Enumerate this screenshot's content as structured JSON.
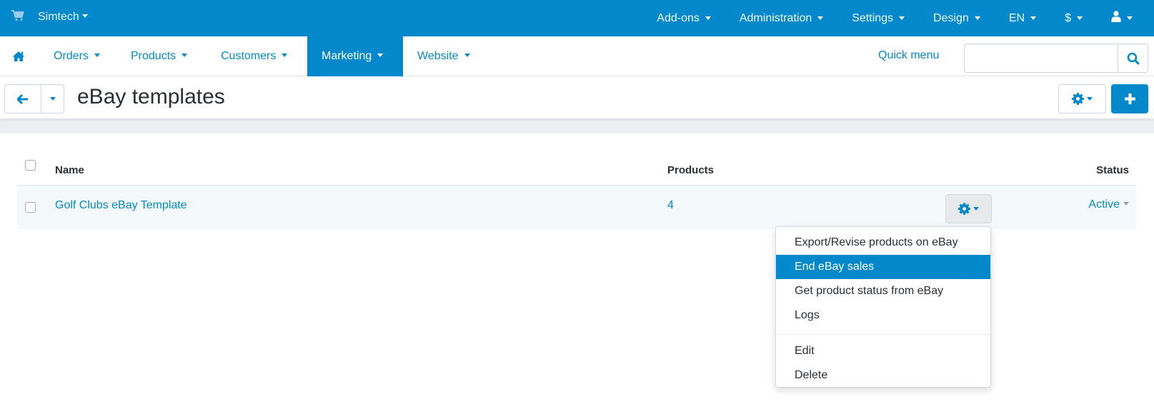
{
  "topbar": {
    "brand": "Simtech",
    "items": [
      {
        "label": "Add-ons"
      },
      {
        "label": "Administration"
      },
      {
        "label": "Settings"
      },
      {
        "label": "Design"
      },
      {
        "label": "EN"
      },
      {
        "label": "$"
      }
    ],
    "user_icon": "user-icon"
  },
  "mainnav": {
    "items": [
      {
        "label": "Orders"
      },
      {
        "label": "Products"
      },
      {
        "label": "Customers"
      },
      {
        "label": "Marketing",
        "active": true
      },
      {
        "label": "Website"
      }
    ],
    "quick_menu": "Quick menu",
    "search": {
      "value": "",
      "placeholder": ""
    }
  },
  "page": {
    "title": "eBay templates"
  },
  "table": {
    "headers": {
      "name": "Name",
      "products": "Products",
      "status": "Status"
    },
    "rows": [
      {
        "name": "Golf Clubs eBay Template",
        "products": "4",
        "status": "Active"
      }
    ]
  },
  "dropdown": {
    "items": [
      {
        "label": "Export/Revise products on eBay"
      },
      {
        "label": "End eBay sales",
        "highlighted": true
      },
      {
        "label": "Get product status from eBay"
      },
      {
        "label": "Logs"
      },
      {
        "label": "Edit"
      },
      {
        "label": "Delete"
      }
    ]
  },
  "colors": {
    "brand": "#0388cc",
    "row_hover": "#f4f9fc",
    "page_strip": "#eceff1"
  }
}
